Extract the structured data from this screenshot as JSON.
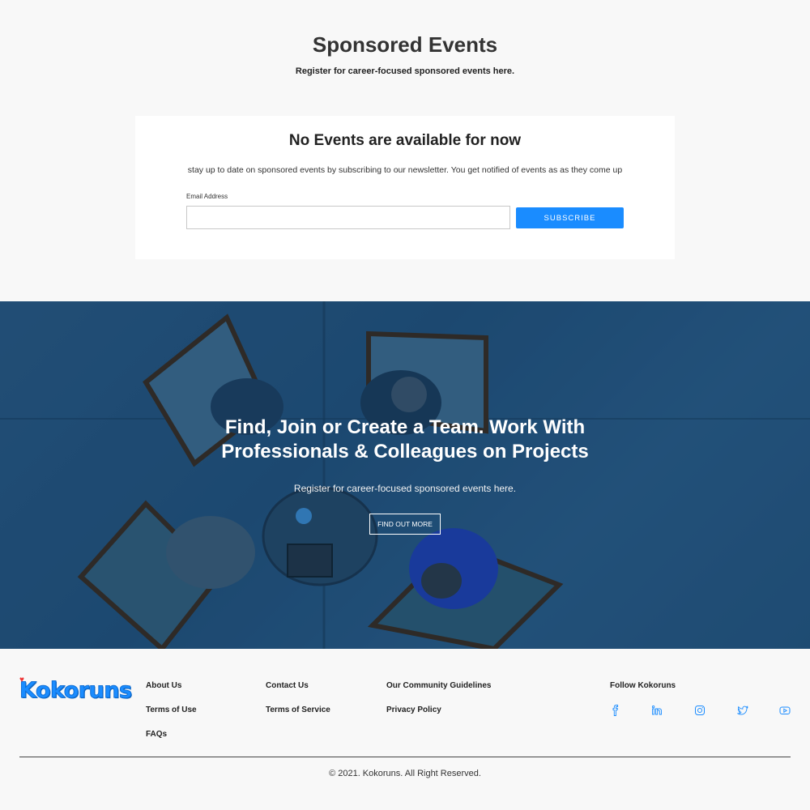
{
  "sponsored": {
    "title": "Sponsored Events",
    "subtitle": "Register for career-focused sponsored events here."
  },
  "card": {
    "title": "No Events are available for now",
    "text": "stay up to date on sponsored events by subscribing to our newsletter. You get notified of events as as they come up",
    "email_label": "Email Address",
    "email_value": "",
    "email_placeholder": "",
    "subscribe_label": "SUBSCRIBE"
  },
  "hero": {
    "title_line1": "Find, Join or Create a Team. Work With",
    "title_line2": "Professionals & Colleagues on Projects",
    "text": "Register for career-focused sponsored events here.",
    "button_label": "FIND OUT MORE"
  },
  "footer": {
    "logo": "Kokoruns",
    "col1": [
      "About Us",
      "Terms of Use",
      "FAQs"
    ],
    "col2": [
      "Contact Us",
      "Terms of Service"
    ],
    "col3": [
      "Our Community Guidelines",
      "Privacy Policy"
    ],
    "follow_title": "Follow Kokoruns",
    "social_icons": [
      "facebook-icon",
      "linkedin-icon",
      "instagram-icon",
      "twitter-icon",
      "youtube-icon"
    ],
    "copyright": "© 2021. Kokoruns. All Right Reserved."
  },
  "colors": {
    "accent": "#1a8cff",
    "hero_bg": "#24557f",
    "page_bg": "#f8f8f8"
  }
}
